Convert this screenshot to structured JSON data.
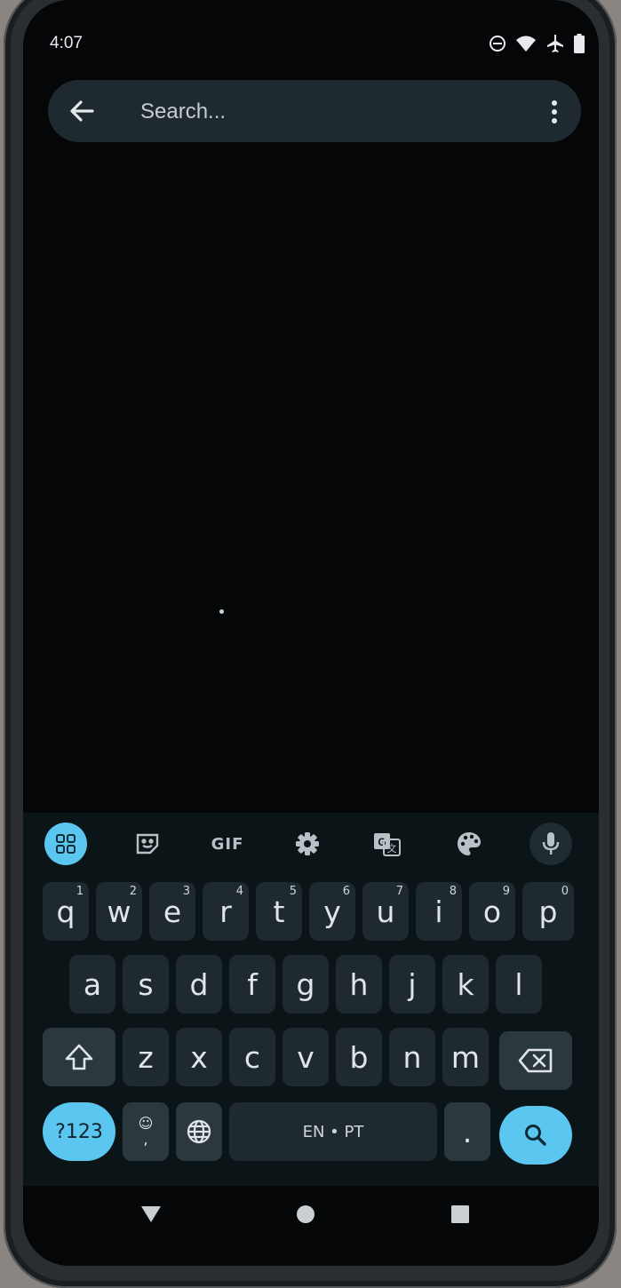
{
  "status_bar": {
    "time": "4:07",
    "icons": [
      "do-not-disturb-icon",
      "wifi-icon",
      "airplane-icon",
      "battery-icon"
    ]
  },
  "search": {
    "placeholder": "Search..."
  },
  "keyboard": {
    "toolbar": [
      "apps-grid-icon",
      "sticker-icon",
      "GIF",
      "settings-icon",
      "translate-icon",
      "palette-icon",
      "mic-icon"
    ],
    "row1": [
      {
        "key": "q",
        "hint": "1"
      },
      {
        "key": "w",
        "hint": "2"
      },
      {
        "key": "e",
        "hint": "3"
      },
      {
        "key": "r",
        "hint": "4"
      },
      {
        "key": "t",
        "hint": "5"
      },
      {
        "key": "y",
        "hint": "6"
      },
      {
        "key": "u",
        "hint": "7"
      },
      {
        "key": "i",
        "hint": "8"
      },
      {
        "key": "o",
        "hint": "9"
      },
      {
        "key": "p",
        "hint": "0"
      }
    ],
    "row2": [
      "a",
      "s",
      "d",
      "f",
      "g",
      "h",
      "j",
      "k",
      "l"
    ],
    "row3": [
      "z",
      "x",
      "c",
      "v",
      "b",
      "n",
      "m"
    ],
    "symbols_label": "?123",
    "emoji_comma": {
      "top": "☺",
      "bottom": ","
    },
    "space_label": "EN • PT",
    "period_label": ".",
    "accent_color": "#5bc6ef"
  },
  "nav": [
    "back-triangle-icon",
    "home-circle-icon",
    "recents-square-icon"
  ]
}
